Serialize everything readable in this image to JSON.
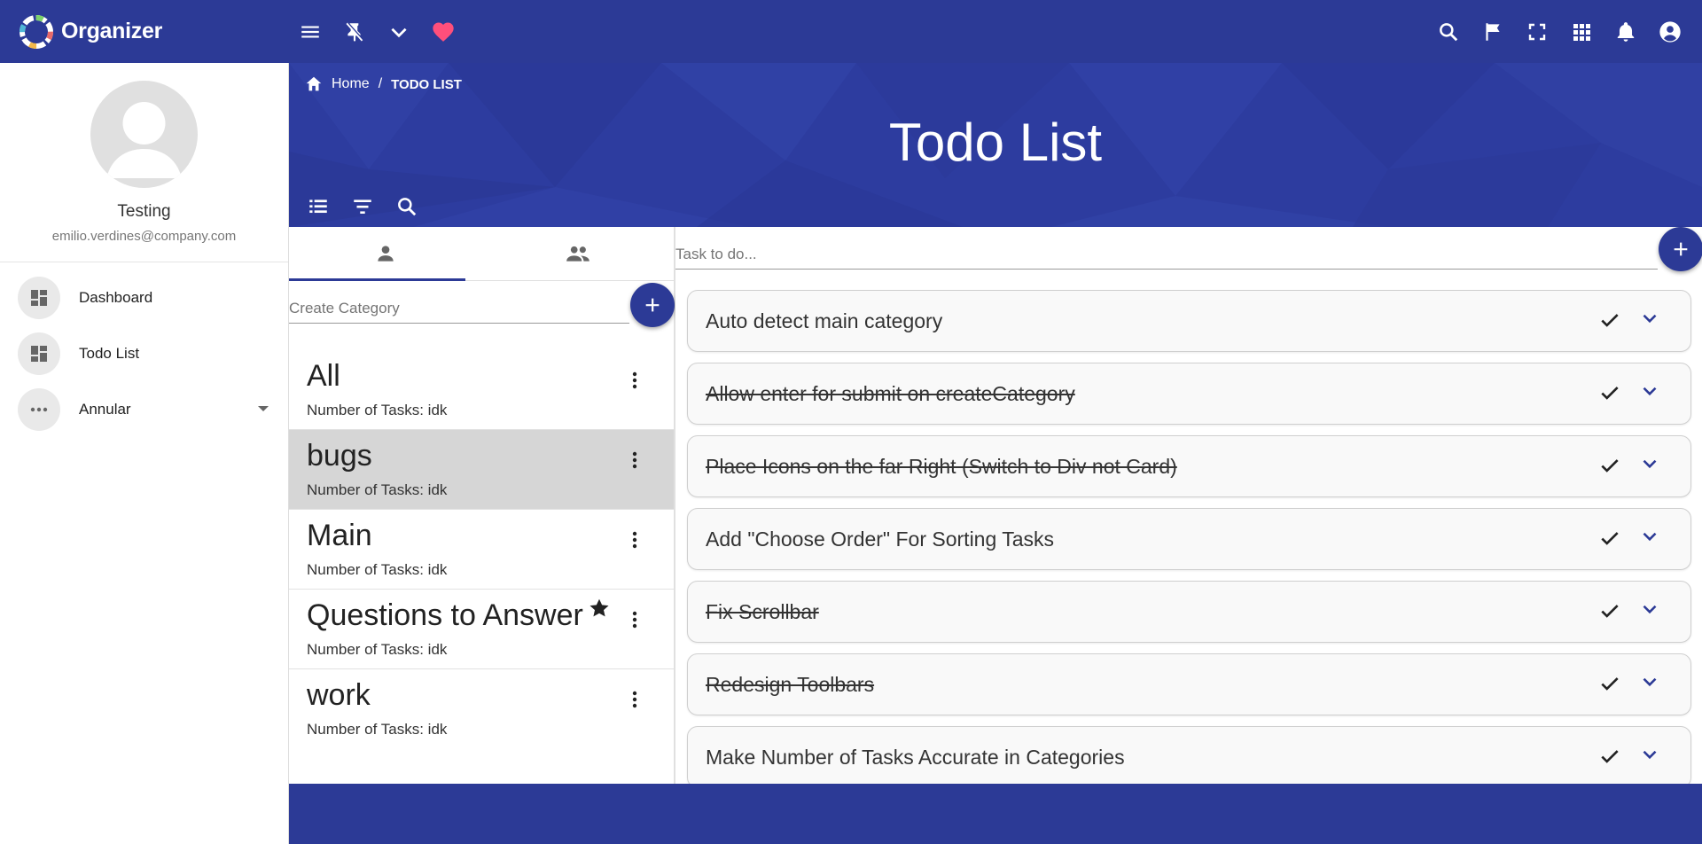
{
  "app": {
    "name": "Organizer"
  },
  "topbar": {
    "left_icons": [
      "menu-icon",
      "pin-off-icon",
      "chevron-down-icon",
      "heart-icon"
    ],
    "right_icons": [
      "search-icon",
      "flag-icon",
      "fullscreen-icon",
      "apps-icon",
      "bell-icon",
      "account-icon"
    ],
    "heart_color": "#ff4f7b"
  },
  "sidebar": {
    "user": {
      "name": "Testing",
      "email": "emilio.verdines@company.com"
    },
    "items": [
      {
        "label": "Dashboard",
        "icon": "dashboard-icon"
      },
      {
        "label": "Todo List",
        "icon": "dashboard-icon"
      },
      {
        "label": "Annular",
        "icon": "more-horiz-icon",
        "expandable": true
      }
    ]
  },
  "breadcrumb": {
    "home": "Home",
    "separator": "/",
    "current": "TODO LIST"
  },
  "page": {
    "title": "Todo List"
  },
  "hero_tools": [
    "list-icon",
    "filter-icon",
    "search-icon"
  ],
  "categories": {
    "tabs": [
      "person-icon",
      "people-icon"
    ],
    "active_tab": 0,
    "create_placeholder": "Create Category",
    "items": [
      {
        "name": "All",
        "count_label": "Number of Tasks: idk",
        "selected": false,
        "starred": false
      },
      {
        "name": "bugs",
        "count_label": "Number of Tasks: idk",
        "selected": true,
        "starred": false
      },
      {
        "name": "Main",
        "count_label": "Number of Tasks: idk",
        "selected": false,
        "starred": false
      },
      {
        "name": "Questions to Answer",
        "count_label": "Number of Tasks: idk",
        "selected": false,
        "starred": true
      },
      {
        "name": "work",
        "count_label": "Number of Tasks: idk",
        "selected": false,
        "starred": false
      }
    ]
  },
  "tasks": {
    "input_placeholder": "Task to do...",
    "items": [
      {
        "text": "Auto detect main category",
        "done": false
      },
      {
        "text": "Allow enter for submit on createCategory",
        "done": true
      },
      {
        "text": "Place Icons on the far Right (Switch to Div not Card)",
        "done": true
      },
      {
        "text": "Add \"Choose Order\" For Sorting Tasks",
        "done": false
      },
      {
        "text": "Fix Scrollbar",
        "done": true
      },
      {
        "text": "Redesign Toolbars",
        "done": true
      },
      {
        "text": "Make Number of Tasks Accurate in Categories",
        "done": false
      }
    ]
  },
  "colors": {
    "primary": "#2c3a96",
    "hero": "#2d3c9f"
  }
}
